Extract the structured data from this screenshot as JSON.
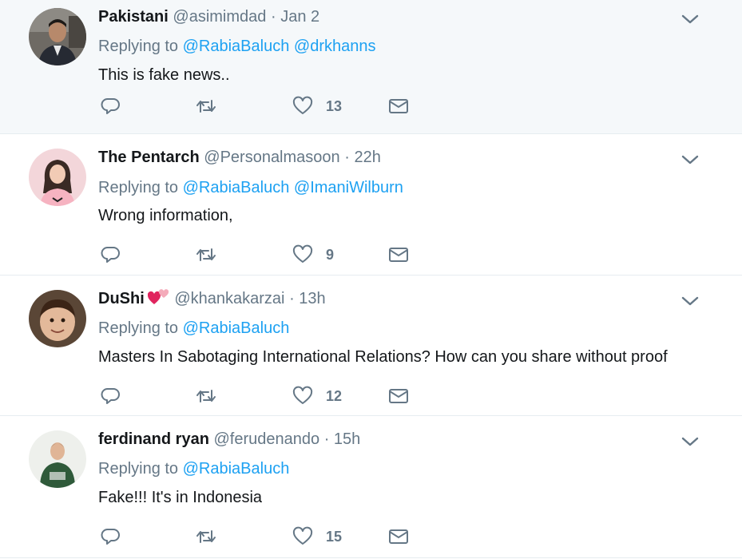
{
  "tweets": [
    {
      "name": "Pakistani",
      "handle": "@asimimdad",
      "dot": "·",
      "time": "Jan 2",
      "replying_label": "Replying to",
      "mentions": [
        "@RabiaBaluch",
        "@drkhanns"
      ],
      "text": "This is fake news..",
      "likes": "13",
      "highlighted": true,
      "avatar": "man-in-suit"
    },
    {
      "name": "The Pentarch",
      "handle": "@Personalmasoon",
      "dot": "·",
      "time": "22h",
      "replying_label": "Replying to",
      "mentions": [
        "@RabiaBaluch",
        "@ImaniWilburn"
      ],
      "text": "Wrong information,",
      "likes": "9",
      "avatar": "illustrated-woman"
    },
    {
      "name": "DuShi",
      "name_emoji": "two-hearts-emoji",
      "handle": "@khankakarzai",
      "dot": "·",
      "time": "13h",
      "replying_label": "Replying to",
      "mentions": [
        "@RabiaBaluch"
      ],
      "text": "Masters In Sabotaging International Relations? How can you share without proof",
      "likes": "12",
      "avatar": "child"
    },
    {
      "name": "ferdinand ryan",
      "handle": "@ferudenando",
      "dot": "·",
      "time": "15h",
      "replying_label": "Replying to",
      "mentions": [
        "@RabiaBaluch"
      ],
      "text": "Fake!!! It's in Indonesia",
      "likes": "15",
      "avatar": "man-green-sweater"
    }
  ],
  "icons": {
    "reply": "reply-icon",
    "retweet": "retweet-icon",
    "like": "heart-icon",
    "dm": "envelope-icon",
    "menu": "chevron-down-icon"
  },
  "colors": {
    "link": "#1da1f2",
    "secondary": "#657786",
    "highlight_bg": "#f5f8fa",
    "divider": "#e6ecf0"
  }
}
